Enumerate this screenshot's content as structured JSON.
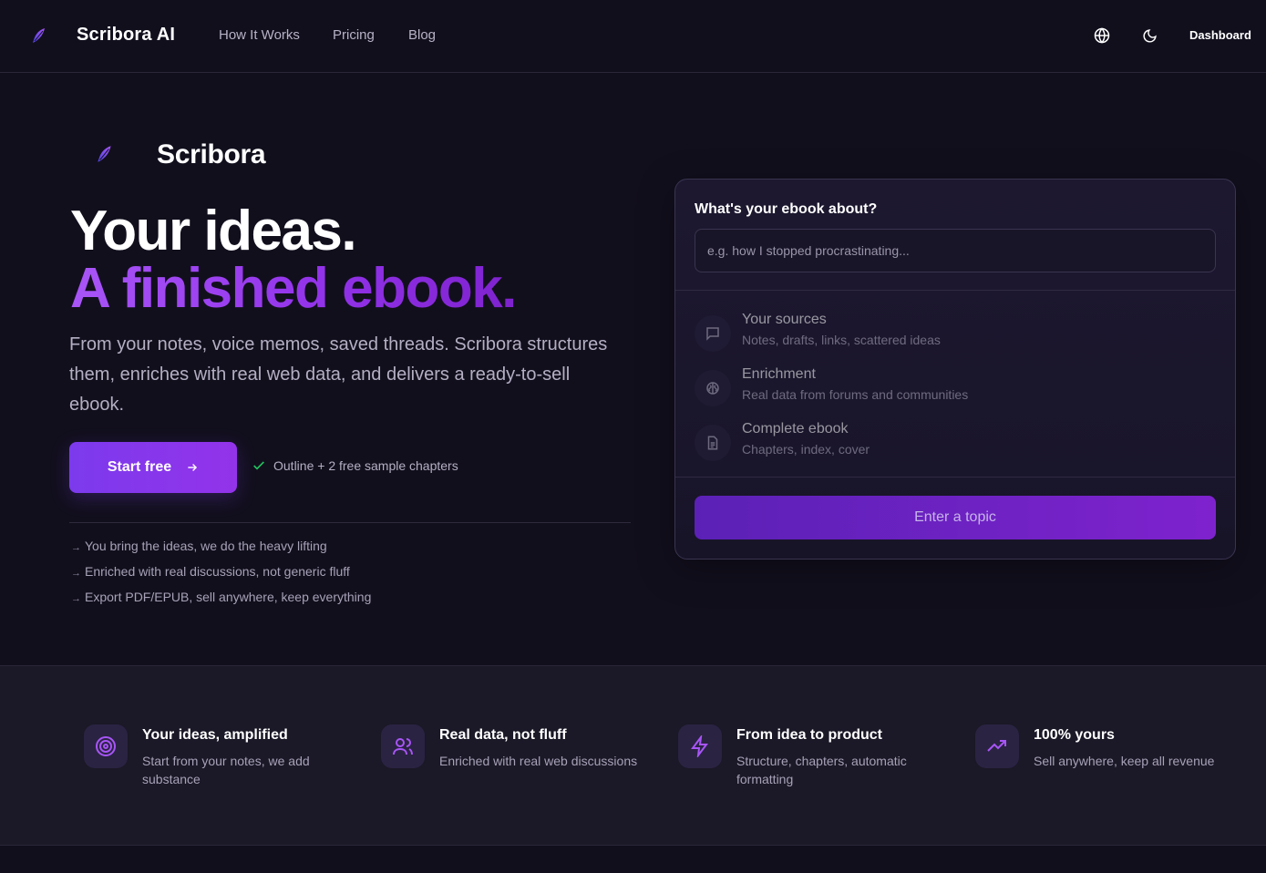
{
  "header": {
    "brand": "Scribora AI",
    "nav": [
      "How It Works",
      "Pricing",
      "Blog"
    ],
    "language_icon": "globe-icon",
    "theme_icon": "moon-icon",
    "dashboard_label": "Dashboard"
  },
  "hero": {
    "logo_text": "Scribora",
    "headline_line1": "Your ideas.",
    "headline_line2": "A finished ebook.",
    "description": "From your notes, voice memos, saved threads. Scribora structures them, enriches with real web data, and delivers a ready-to-sell ebook.",
    "cta_label": "Start free",
    "cta_note": "Outline + 2 free sample chapters",
    "bullets": [
      "You bring the ideas, we do the heavy lifting",
      "Enriched with real discussions, not generic fluff",
      "Export PDF/EPUB, sell anywhere, keep everything"
    ]
  },
  "form": {
    "question": "What's your ebook about?",
    "input_value": "",
    "input_placeholder": "e.g. how I stopped procrastinating...",
    "steps": [
      {
        "title": "Your sources",
        "subtitle": "Notes, drafts, links, scattered ideas",
        "icon": "chat-bubble-icon"
      },
      {
        "title": "Enrichment",
        "subtitle": "Real data from forums and communities",
        "icon": "brain-icon"
      },
      {
        "title": "Complete ebook",
        "subtitle": "Chapters, index, cover",
        "icon": "document-icon"
      }
    ],
    "submit_label": "Enter a topic"
  },
  "features": [
    {
      "title": "Your ideas, amplified",
      "subtitle": "Start from your notes, we add substance",
      "icon": "target-icon"
    },
    {
      "title": "Real data, not fluff",
      "subtitle": "Enriched with real web discussions",
      "icon": "users-icon"
    },
    {
      "title": "From idea to product",
      "subtitle": "Structure, chapters, automatic formatting",
      "icon": "lightning-icon"
    },
    {
      "title": "100% yours",
      "subtitle": "Sell anywhere, keep all revenue",
      "icon": "trending-up-icon"
    }
  ],
  "colors": {
    "background": "#120f1d",
    "accent": "#9333ea",
    "accent_light": "#a855f7",
    "check": "#22c55e"
  }
}
